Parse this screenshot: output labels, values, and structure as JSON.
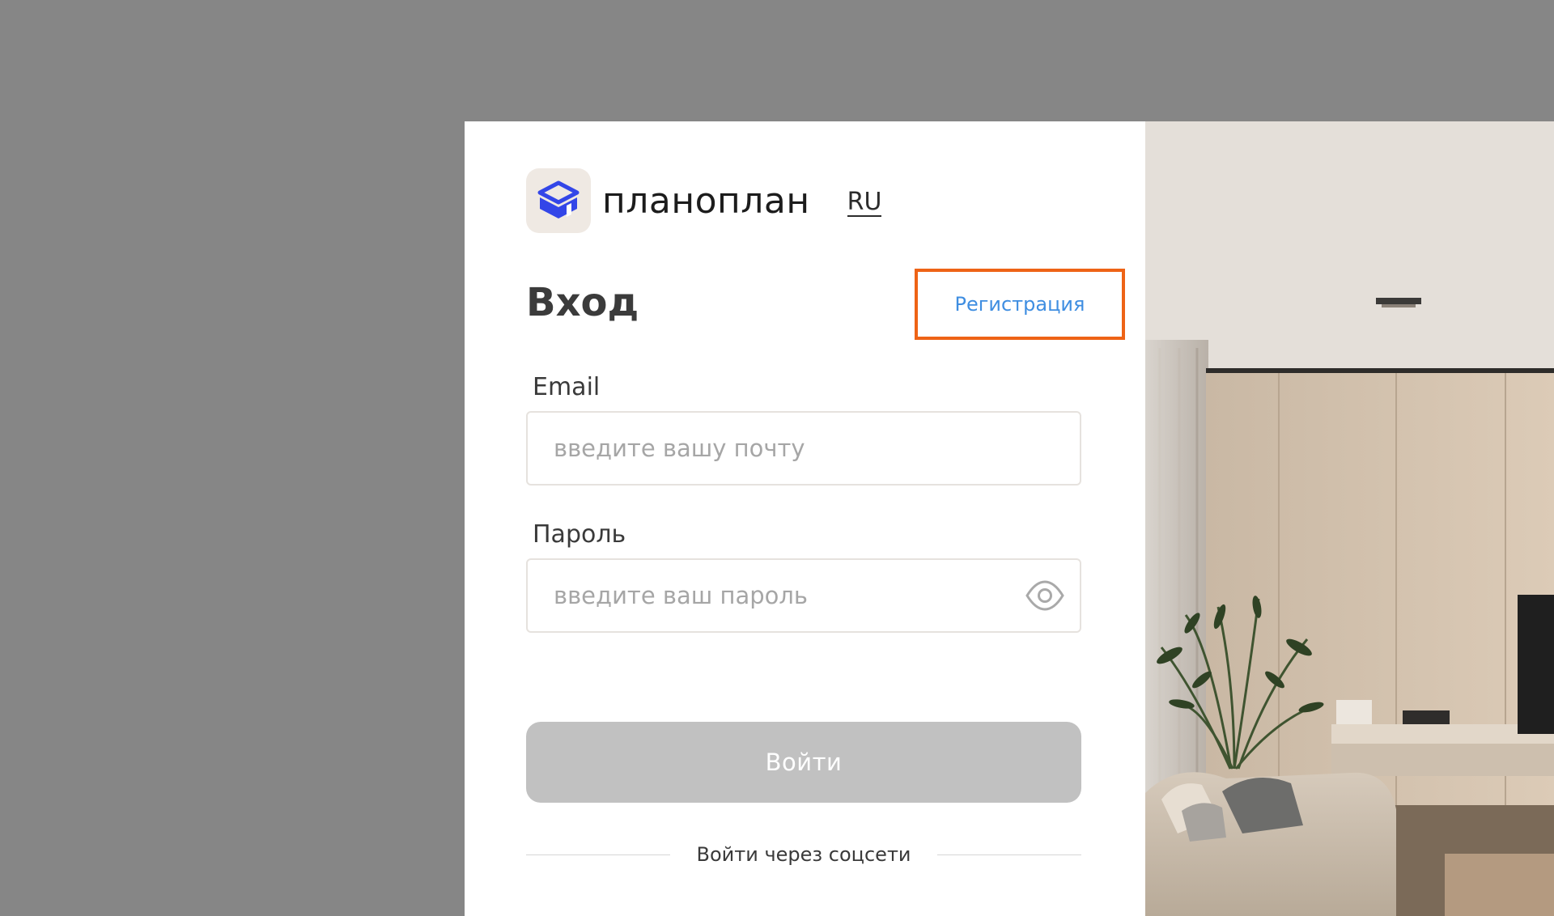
{
  "brand": {
    "name": "планоплан",
    "language": "RU"
  },
  "login": {
    "title": "Вход",
    "register_link": "Регистрация",
    "email_label": "Email",
    "email_placeholder": "введите вашу почту",
    "password_label": "Пароль",
    "password_placeholder": "введите ваш пароль",
    "submit_label": "Войти",
    "social_label": "Войти через соцсети"
  },
  "colors": {
    "backdrop": "#868686",
    "logo_accent": "#3346e8",
    "link": "#3f8ee1",
    "highlight_outline": "#ee6316",
    "disabled_button": "#c1c1c1"
  },
  "icons": {
    "logo": "planoplan-cube-icon",
    "password_visibility": "eye-icon"
  }
}
